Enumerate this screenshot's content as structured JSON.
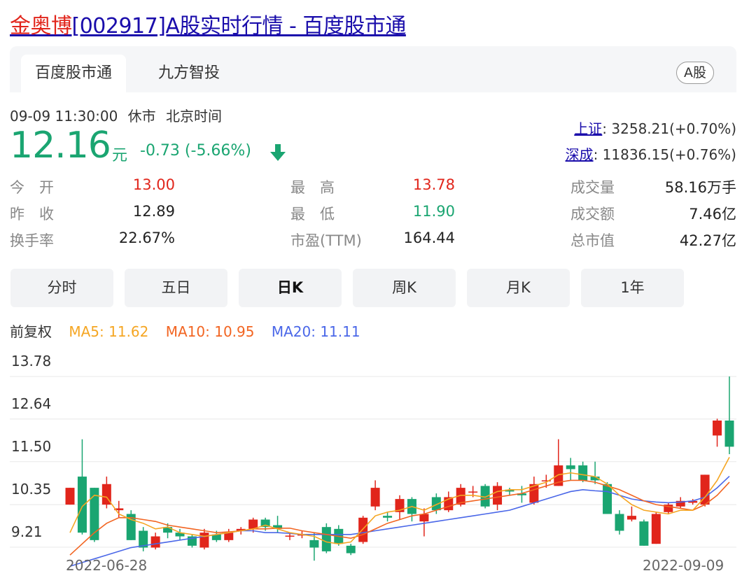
{
  "header": {
    "stock_name": "金奥博",
    "title_rest": "[002917]A股实时行情 - 百度股市通"
  },
  "tabs": {
    "tab1": "百度股市通",
    "tab2": "九方智投",
    "badge": "A股"
  },
  "status": {
    "datetime": "09-09 11:30:00",
    "market": "休市",
    "tz": "北京时间"
  },
  "quote": {
    "price": "12.16",
    "unit": "元",
    "change": "-0.73 (-5.66%)"
  },
  "indices": {
    "sh_label": "上证",
    "sh_value": ": 3258.21(+0.70%)",
    "sz_label": "深成",
    "sz_value": ": 11836.15(+0.76%)"
  },
  "stats": {
    "open_label": "今　开",
    "open_value": "13.00",
    "prev_label": "昨　收",
    "prev_value": "12.89",
    "turnover_label": "换手率",
    "turnover_value": "22.67%",
    "high_label": "最　高",
    "high_value": "13.78",
    "low_label": "最　低",
    "low_value": "11.90",
    "pe_label": "市盈(TTM)",
    "pe_value": "164.44",
    "volume_label": "成交量",
    "volume_value": "58.16万手",
    "amount_label": "成交额",
    "amount_value": "7.46亿",
    "mcap_label": "总市值",
    "mcap_value": "42.27亿"
  },
  "periods": [
    "分时",
    "五日",
    "日K",
    "周K",
    "月K",
    "1年"
  ],
  "active_period": "日K",
  "legend": {
    "adj": "前复权",
    "ma5": "MA5: 11.62",
    "ma10": "MA10: 10.95",
    "ma20": "MA20: 11.11"
  },
  "colors": {
    "up": "#e1251b",
    "down": "#1aa571",
    "ma5": "#f5a623",
    "ma10": "#f26522",
    "ma20": "#4a67e8",
    "link": "#1a0dab"
  },
  "chart_data": {
    "type": "candlestick",
    "y_ticks": [
      "13.78",
      "12.64",
      "11.50",
      "10.35",
      "9.21"
    ],
    "x_labels": [
      "2022-06-28",
      "2022-09-09"
    ],
    "ylim": [
      8.8,
      14.2
    ],
    "candles": [
      {
        "o": 10.35,
        "c": 10.8,
        "h": 10.8,
        "l": 10.35
      },
      {
        "o": 11.1,
        "c": 9.6,
        "h": 12.1,
        "l": 9.55
      },
      {
        "o": 10.8,
        "c": 9.4,
        "h": 10.8,
        "l": 9.35
      },
      {
        "o": 10.35,
        "c": 10.9,
        "h": 11.1,
        "l": 10.25
      },
      {
        "o": 10.2,
        "c": 10.25,
        "h": 10.45,
        "l": 10.0
      },
      {
        "o": 10.1,
        "c": 9.4,
        "h": 10.2,
        "l": 9.4
      },
      {
        "o": 9.65,
        "c": 9.2,
        "h": 9.75,
        "l": 9.1
      },
      {
        "o": 9.2,
        "c": 9.5,
        "h": 9.6,
        "l": 9.15
      },
      {
        "o": 9.75,
        "c": 9.6,
        "h": 9.85,
        "l": 9.45
      },
      {
        "o": 9.6,
        "c": 9.5,
        "h": 9.7,
        "l": 9.4
      },
      {
        "o": 9.5,
        "c": 9.25,
        "h": 9.55,
        "l": 9.2
      },
      {
        "o": 9.2,
        "c": 9.6,
        "h": 9.7,
        "l": 9.15
      },
      {
        "o": 9.55,
        "c": 9.4,
        "h": 9.65,
        "l": 9.35
      },
      {
        "o": 9.4,
        "c": 9.6,
        "h": 9.7,
        "l": 9.35
      },
      {
        "o": 9.65,
        "c": 9.7,
        "h": 9.75,
        "l": 9.55
      },
      {
        "o": 9.7,
        "c": 9.95,
        "h": 10.0,
        "l": 9.6
      },
      {
        "o": 9.95,
        "c": 9.75,
        "h": 10.0,
        "l": 9.65
      },
      {
        "o": 9.8,
        "c": 9.7,
        "h": 10.05,
        "l": 9.6
      },
      {
        "o": 9.52,
        "c": 9.52,
        "h": 9.6,
        "l": 9.4
      },
      {
        "o": 9.55,
        "c": 9.55,
        "h": 9.65,
        "l": 9.45
      },
      {
        "o": 9.4,
        "c": 9.2,
        "h": 9.6,
        "l": 8.85
      },
      {
        "o": 9.75,
        "c": 9.1,
        "h": 9.85,
        "l": 9.05
      },
      {
        "o": 9.7,
        "c": 9.3,
        "h": 9.8,
        "l": 9.25
      },
      {
        "o": 9.25,
        "c": 9.05,
        "h": 9.3,
        "l": 9.0
      },
      {
        "o": 9.35,
        "c": 10.0,
        "h": 10.05,
        "l": 9.3
      },
      {
        "o": 10.3,
        "c": 10.8,
        "h": 11.0,
        "l": 10.2
      },
      {
        "o": 10.05,
        "c": 10.0,
        "h": 10.15,
        "l": 9.9
      },
      {
        "o": 10.15,
        "c": 10.5,
        "h": 10.6,
        "l": 9.95
      },
      {
        "o": 10.5,
        "c": 10.1,
        "h": 10.55,
        "l": 9.9
      },
      {
        "o": 9.9,
        "c": 10.1,
        "h": 10.25,
        "l": 9.5
      },
      {
        "o": 10.55,
        "c": 10.2,
        "h": 10.65,
        "l": 10.1
      },
      {
        "o": 10.2,
        "c": 10.55,
        "h": 10.7,
        "l": 10.15
      },
      {
        "o": 10.35,
        "c": 10.8,
        "h": 10.9,
        "l": 10.3
      },
      {
        "o": 10.7,
        "c": 10.7,
        "h": 10.85,
        "l": 10.55
      },
      {
        "o": 10.85,
        "c": 10.3,
        "h": 10.9,
        "l": 10.25
      },
      {
        "o": 10.35,
        "c": 10.85,
        "h": 10.95,
        "l": 10.2
      },
      {
        "o": 10.75,
        "c": 10.7,
        "h": 10.8,
        "l": 10.6
      },
      {
        "o": 10.65,
        "c": 10.6,
        "h": 10.85,
        "l": 10.4
      },
      {
        "o": 10.4,
        "c": 10.9,
        "h": 11.1,
        "l": 10.35
      },
      {
        "o": 11.0,
        "c": 11.0,
        "h": 11.15,
        "l": 10.8
      },
      {
        "o": 10.85,
        "c": 11.4,
        "h": 12.1,
        "l": 10.85
      },
      {
        "o": 11.4,
        "c": 11.3,
        "h": 11.6,
        "l": 11.0
      },
      {
        "o": 11.4,
        "c": 11.0,
        "h": 11.5,
        "l": 10.95
      },
      {
        "o": 11.1,
        "c": 11.0,
        "h": 11.5,
        "l": 10.9
      },
      {
        "o": 10.9,
        "c": 10.1,
        "h": 10.95,
        "l": 10.1
      },
      {
        "o": 10.1,
        "c": 9.65,
        "h": 10.2,
        "l": 9.55
      },
      {
        "o": 9.95,
        "c": 10.05,
        "h": 10.3,
        "l": 9.9
      },
      {
        "o": 9.9,
        "c": 9.25,
        "h": 9.95,
        "l": 9.25
      },
      {
        "o": 9.3,
        "c": 10.1,
        "h": 10.15,
        "l": 9.3
      },
      {
        "o": 10.15,
        "c": 10.35,
        "h": 10.4,
        "l": 10.1
      },
      {
        "o": 10.3,
        "c": 10.45,
        "h": 10.55,
        "l": 10.25
      },
      {
        "o": 10.4,
        "c": 10.45,
        "h": 10.5,
        "l": 10.35
      },
      {
        "o": 10.35,
        "c": 11.15,
        "h": 11.15,
        "l": 10.3
      },
      {
        "o": 12.2,
        "c": 12.6,
        "h": 12.65,
        "l": 11.9
      },
      {
        "o": 12.6,
        "c": 11.9,
        "h": 13.78,
        "l": 11.7
      }
    ],
    "ma5": [
      9.6,
      10.3,
      10.6,
      10.55,
      10.1,
      9.95,
      9.85,
      9.7,
      9.75,
      9.6,
      9.55,
      9.5,
      9.55,
      9.6,
      9.65,
      9.7,
      9.8,
      9.7,
      9.6,
      9.55,
      9.5,
      9.35,
      9.3,
      9.35,
      9.7,
      10.05,
      10.15,
      10.2,
      10.3,
      10.2,
      10.35,
      10.5,
      10.6,
      10.6,
      10.55,
      10.7,
      10.75,
      10.75,
      10.85,
      10.95,
      11.15,
      11.2,
      11.15,
      11.1,
      10.9,
      10.6,
      10.35,
      10.2,
      10.15,
      10.1,
      10.2,
      10.2,
      10.55,
      11.0,
      11.62
    ],
    "ma10": [
      9.0,
      9.3,
      9.6,
      9.85,
      10.0,
      10.0,
      9.95,
      9.9,
      9.8,
      9.75,
      9.7,
      9.65,
      9.6,
      9.62,
      9.65,
      9.7,
      9.7,
      9.72,
      9.72,
      9.65,
      9.6,
      9.55,
      9.5,
      9.45,
      9.55,
      9.7,
      9.85,
      9.95,
      10.05,
      10.1,
      10.2,
      10.3,
      10.4,
      10.45,
      10.5,
      10.55,
      10.6,
      10.65,
      10.75,
      10.85,
      10.95,
      11.0,
      11.0,
      10.95,
      10.85,
      10.75,
      10.6,
      10.45,
      10.35,
      10.3,
      10.25,
      10.2,
      10.35,
      10.6,
      10.95
    ],
    "ma20": [
      8.7,
      8.8,
      8.9,
      9.0,
      9.1,
      9.2,
      9.25,
      9.3,
      9.35,
      9.4,
      9.45,
      9.5,
      9.55,
      9.6,
      9.65,
      9.65,
      9.6,
      9.6,
      9.58,
      9.55,
      9.55,
      9.55,
      9.55,
      9.55,
      9.6,
      9.65,
      9.7,
      9.75,
      9.8,
      9.85,
      9.9,
      9.95,
      10.0,
      10.05,
      10.1,
      10.15,
      10.2,
      10.3,
      10.4,
      10.5,
      10.6,
      10.7,
      10.75,
      10.72,
      10.7,
      10.6,
      10.5,
      10.45,
      10.42,
      10.4,
      10.42,
      10.45,
      10.55,
      10.8,
      11.11
    ]
  }
}
